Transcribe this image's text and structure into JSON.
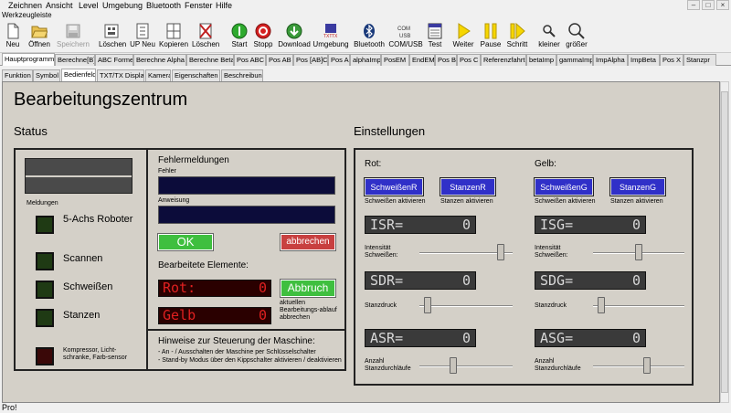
{
  "menu": [
    "Zeichnen",
    "Ansicht",
    "Level",
    "Umgebung",
    "Bluetooth",
    "Fenster",
    "Hilfe"
  ],
  "window_controls": [
    "–",
    "□",
    "×"
  ],
  "toolbar_title": "Werkzeugleiste",
  "toolbar": [
    {
      "label": "Neu",
      "icon": "new-file-icon"
    },
    {
      "label": "Öffnen",
      "icon": "open-folder-icon"
    },
    {
      "label": "Speichern",
      "icon": "save-icon",
      "disabled": true
    },
    {
      "label": "Löschen",
      "icon": "delete-icon"
    },
    {
      "label": "UP Neu",
      "icon": "new-subprogram-icon"
    },
    {
      "label": "Kopieren",
      "icon": "copy-icon"
    },
    {
      "label": "Löschen",
      "icon": "delete-subprogram-icon"
    },
    {
      "label": "Start",
      "icon": "start-icon"
    },
    {
      "label": "Stopp",
      "icon": "stop-icon"
    },
    {
      "label": "Download",
      "icon": "download-icon"
    },
    {
      "label": "Umgebung",
      "icon": "environment-icon"
    },
    {
      "label": "Bluetooth",
      "icon": "bluetooth-icon"
    },
    {
      "label": "COM/USB",
      "icon": "com-usb-icon"
    },
    {
      "label": "Test",
      "icon": "test-icon"
    },
    {
      "label": "Weiter",
      "icon": "play-icon"
    },
    {
      "label": "Pause",
      "icon": "pause-icon"
    },
    {
      "label": "Schritt",
      "icon": "step-icon"
    },
    {
      "label": "kleiner",
      "icon": "zoom-out-icon"
    },
    {
      "label": "größer",
      "icon": "zoom-in-icon"
    }
  ],
  "icon_text": {
    "txt": "TXT",
    "tx": "TX",
    "com": "COM",
    "usb": "USB"
  },
  "tabs": [
    "Hauptprogramm",
    "Berechne[B]",
    "ABC Formel",
    "Berechne Alpha",
    "Berechne Beta",
    "Pos ABC",
    "Pos AB",
    "Pos [AB]C",
    "Pos A",
    "alphaImp",
    "PosEM",
    "EndEM",
    "Pos B",
    "Pos C",
    "Referenzfahrt",
    "betaImp",
    "gammaImp",
    "ImpAlpha",
    "ImpBeta",
    "Pos X",
    "Stanzpr"
  ],
  "subtabs": [
    "Funktion",
    "Symbol",
    "Bedienfeld",
    "TXT/TX Display",
    "Kamera",
    "Eigenschaften",
    "Beschreibung"
  ],
  "panel": {
    "title": "Bearbeitungszentrum",
    "status_title": "Status",
    "settings_title": "Einstellungen",
    "meldungen": "Meldungen",
    "robot_label": "5-Achs Roboter",
    "scannen": "Scannen",
    "schweissen": "Schweißen",
    "stanzen": "Stanzen",
    "kompressor": "Kompressor, Licht-schranke, Farb-sensor",
    "fehlermeldungen": "Fehlermeldungen",
    "fehler": "Fehler",
    "anweisung": "Anweisung",
    "ok": "OK",
    "abbrechen": "abbrechen",
    "bearbeitete": "Bearbeitete Elemente:",
    "rot_label": "Rot:",
    "rot_value": "0",
    "gelb_label": "Gelb",
    "gelb_value": "0",
    "abbruch": "Abbruch",
    "abbruch_desc": "aktuellen Bearbeitungs-ablauf abbrechen",
    "hinweise_title": "Hinweise zur Steuerung der Maschine:",
    "hinweise_1": "- An - / Ausschalten der Maschine per Schlüsselschalter",
    "hinweise_2": "- Stand-by Modus über den Kippschalter aktivieren / deaktivieren",
    "rot": "Rot:",
    "gelb": "Gelb:",
    "schweissenR": "SchweißenR",
    "stanzenR": "StanzenR",
    "schweissenG": "SchweißenG",
    "stanzenG": "StanzenG",
    "schweissen_aktiv": "Schweißen aktivieren",
    "stanzen_aktiv": "Stanzen aktivieren",
    "isr": "ISR=",
    "isr_val": "0",
    "isg": "ISG=",
    "isg_val": "0",
    "sdr": "SDR=",
    "sdr_val": "0",
    "sdg": "SDG=",
    "sdg_val": "0",
    "asr": "ASR=",
    "asr_val": "0",
    "asg": "ASG=",
    "asg_val": "0",
    "intensitaet": "Intensität Schweißen:",
    "stanzdruck": "Stanzdruck",
    "anzahl": "Anzahl Stanzdurchläufe"
  },
  "sliders": {
    "int_r": 0.9,
    "int_g": 0.5,
    "sd_r": 0.05,
    "sd_g": 0.05,
    "anz_r": 0.35,
    "anz_g": 0.6
  },
  "status_bar": "Pro!"
}
